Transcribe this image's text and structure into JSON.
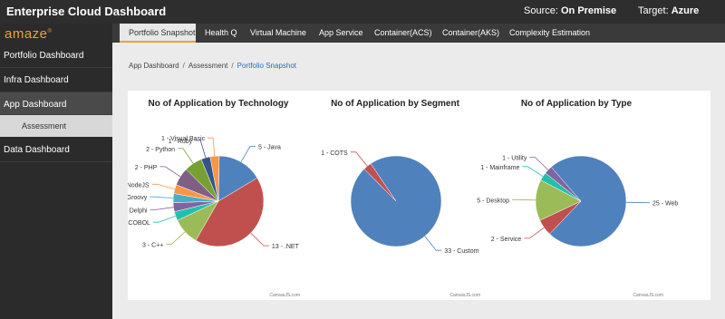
{
  "header": {
    "title": "Enterprise Cloud Dashboard",
    "source_label": "Source:",
    "source_value": "On Premise",
    "target_label": "Target:",
    "target_value": "Azure"
  },
  "sidebar": {
    "logo": "amaze",
    "logo_mark": "®",
    "items": [
      {
        "label": "Portfolio Dashboard"
      },
      {
        "label": "Infra Dashboard"
      },
      {
        "label": "App Dashboard"
      },
      {
        "label": "Data Dashboard"
      }
    ],
    "subitem": "Assessment"
  },
  "tabs": [
    {
      "label": "Portfolio Snapshot",
      "active": true
    },
    {
      "label": "Health Q"
    },
    {
      "label": "Virtual Machine"
    },
    {
      "label": "App Service"
    },
    {
      "label": "Container(ACS)"
    },
    {
      "label": "Container(AKS)"
    },
    {
      "label": "Complexity Estimation"
    }
  ],
  "breadcrumb": {
    "items": [
      "App Dashboard",
      "Assessment"
    ],
    "current": "Portfolio Snapshot"
  },
  "colors": {
    "accent": "#e8a33d",
    "link": "#2a6eb8"
  },
  "chart_data": [
    {
      "type": "pie",
      "title": "No of Application by Technology",
      "credit": "CanvasJS.com",
      "slices": [
        {
          "label": "Java",
          "value": 5,
          "color": "#4f81bc"
        },
        {
          "label": ".NET",
          "value": 13,
          "color": "#c0504e"
        },
        {
          "label": "C++",
          "value": 3,
          "color": "#9bbb58"
        },
        {
          "label": "COBOL",
          "value": 1,
          "color": "#23bfaa"
        },
        {
          "label": "Delphi",
          "value": 1,
          "color": "#8064a1"
        },
        {
          "label": "Groovy",
          "value": 1,
          "color": "#4aacc5"
        },
        {
          "label": "NodeJS",
          "value": 1,
          "color": "#f79647"
        },
        {
          "label": "PHP",
          "value": 2,
          "color": "#7f6084"
        },
        {
          "label": "Python",
          "value": 2,
          "color": "#77a033"
        },
        {
          "label": "Ruby",
          "value": 1,
          "color": "#33558b"
        },
        {
          "label": "Visual Basic",
          "value": 1,
          "color": "#f79647"
        }
      ]
    },
    {
      "type": "pie",
      "title": "No of Application by Segment",
      "credit": "CanvasJS.com",
      "slices": [
        {
          "label": "Custom",
          "value": 33,
          "color": "#4f81bc"
        },
        {
          "label": "COTS",
          "value": 1,
          "color": "#c0504e"
        }
      ]
    },
    {
      "type": "pie",
      "title": "No of Application by Type",
      "credit": "CanvasJS.com",
      "slices": [
        {
          "label": "Web",
          "value": 25,
          "color": "#4f81bc"
        },
        {
          "label": "Service",
          "value": 2,
          "color": "#c0504e"
        },
        {
          "label": "Desktop",
          "value": 5,
          "color": "#9bbb58"
        },
        {
          "label": "Mainframe",
          "value": 1,
          "color": "#23bfaa"
        },
        {
          "label": "Utility",
          "value": 1,
          "color": "#8064a1"
        }
      ]
    }
  ]
}
